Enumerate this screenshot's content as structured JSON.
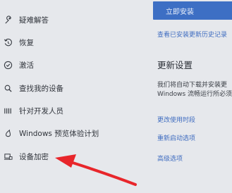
{
  "sidebar": {
    "items": [
      {
        "label": "疑难解答",
        "icon": "wrench-icon"
      },
      {
        "label": "恢复",
        "icon": "restore-icon"
      },
      {
        "label": "激活",
        "icon": "activation-check-icon"
      },
      {
        "label": "查找我的设备",
        "icon": "find-device-icon"
      },
      {
        "label": "针对开发人员",
        "icon": "developer-icon"
      },
      {
        "label": "Windows 预览体验计划",
        "icon": "windows-insider-icon"
      },
      {
        "label": "设备加密",
        "icon": "device-encryption-icon"
      }
    ]
  },
  "main": {
    "install_button": "立即安装",
    "history_link": "查看已安装更新历史记录",
    "update_settings_title": "更新设置",
    "desc_line1": "我们将自动下载并安装更",
    "desc_line2": "Windows 流畅运行所必须",
    "links": [
      "更改使用时段",
      "重新启动选项",
      "高级选项"
    ]
  },
  "annotation": {
    "color": "#e8262b"
  },
  "colors": {
    "accent": "#3d6fc4",
    "link": "#3f6cc0",
    "background": "#e6e8ec"
  }
}
